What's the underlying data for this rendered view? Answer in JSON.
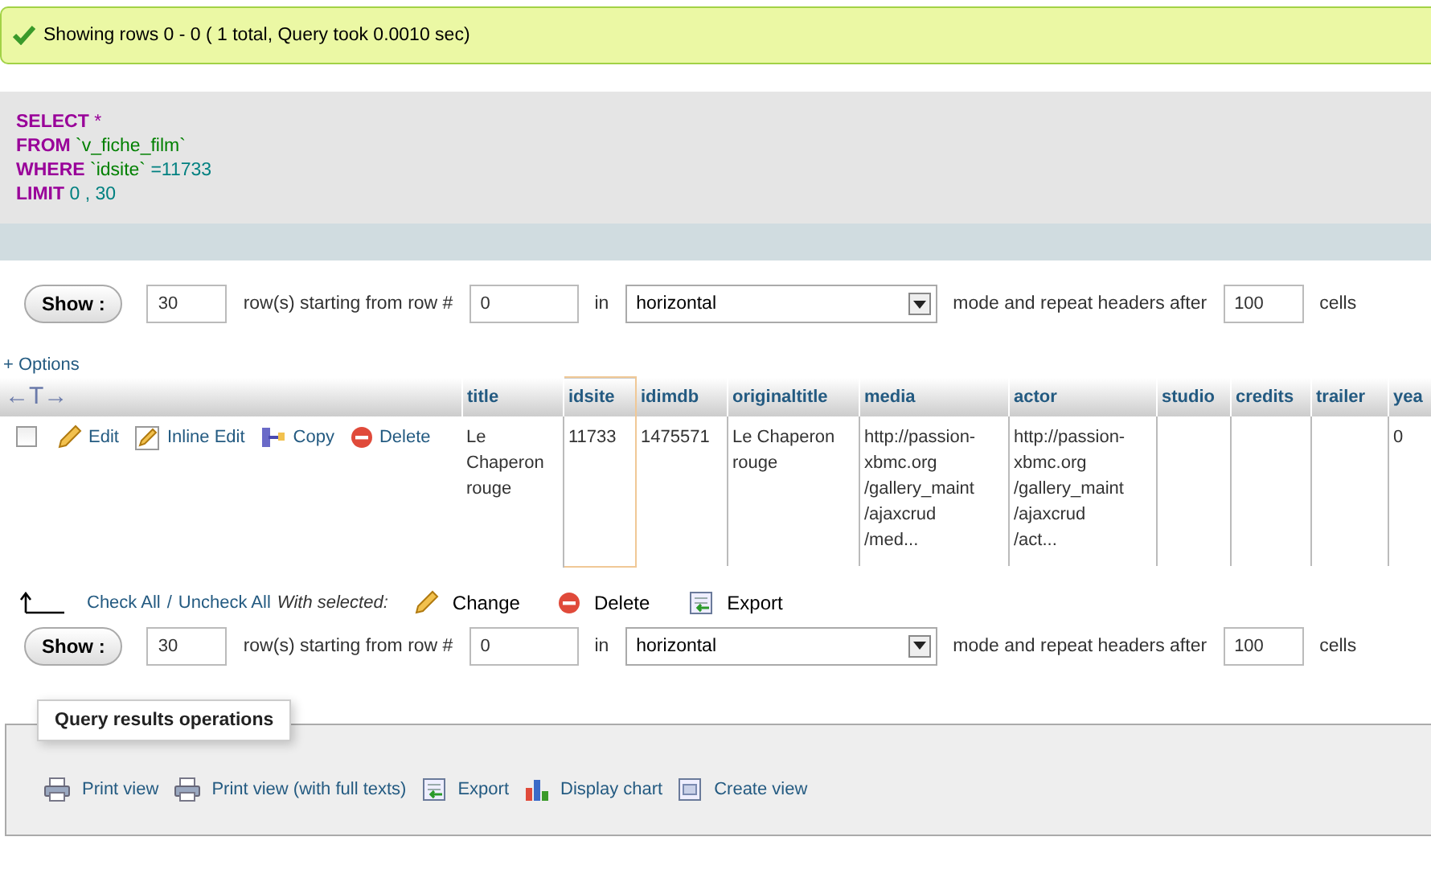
{
  "message": {
    "text": "Showing rows 0 - 0 ( 1 total, Query took 0.0010 sec)"
  },
  "sql": {
    "lines": [
      [
        {
          "kind": "keyword",
          "text": "SELECT"
        },
        {
          "kind": "keyword",
          "text": "*"
        }
      ],
      [
        {
          "kind": "keyword",
          "text": "FROM"
        },
        {
          "kind": "identifier",
          "text": "`v_fiche_film`"
        }
      ],
      [
        {
          "kind": "keyword",
          "text": "WHERE"
        },
        {
          "kind": "identifier",
          "text": "`idsite`"
        },
        {
          "kind": "number",
          "text": "=11733"
        }
      ],
      [
        {
          "kind": "keyword",
          "text": "LIMIT"
        },
        {
          "kind": "number",
          "text": "0 , 30"
        }
      ]
    ]
  },
  "nav_top": {
    "show_button": "Show :",
    "rows_value": "30",
    "rows_label": "row(s) starting from row #",
    "start_value": "0",
    "in_label": "in",
    "mode_value": "horizontal",
    "repeat_label": "mode and repeat headers after",
    "repeat_value": "100",
    "cells_label": "cells"
  },
  "options_link": "+ Options",
  "table": {
    "sort_handle": "←T→",
    "columns": [
      {
        "label": "title",
        "highlighted": false
      },
      {
        "label": "idsite",
        "highlighted": true
      },
      {
        "label": "idimdb",
        "highlighted": false
      },
      {
        "label": "originaltitle",
        "highlighted": false
      },
      {
        "label": "media",
        "highlighted": false
      },
      {
        "label": "actor",
        "highlighted": false
      },
      {
        "label": "studio",
        "highlighted": false
      },
      {
        "label": "credits",
        "highlighted": false
      },
      {
        "label": "trailer",
        "highlighted": false
      },
      {
        "label": "yea",
        "highlighted": false
      }
    ],
    "rows": [
      {
        "checked": false,
        "actions": [
          {
            "kind": "edit",
            "label": "Edit"
          },
          {
            "kind": "inline_edit",
            "label": "Inline Edit"
          },
          {
            "kind": "copy",
            "label": "Copy"
          },
          {
            "kind": "delete",
            "label": "Delete"
          }
        ],
        "cells": [
          [
            "Le",
            "Chaperon",
            "rouge"
          ],
          [
            "11733"
          ],
          [
            "1475571"
          ],
          [
            "Le Chaperon",
            "rouge"
          ],
          [
            "http://passion-",
            "xbmc.org",
            "/gallery_maint",
            "/ajaxcrud",
            "/med..."
          ],
          [
            "http://passion-",
            "xbmc.org",
            "/gallery_maint",
            "/ajaxcrud",
            "/act..."
          ],
          [],
          [],
          [],
          [
            "0"
          ]
        ]
      }
    ]
  },
  "bulk": {
    "check_all": "Check All",
    "separator": "/",
    "uncheck_all": "Uncheck All",
    "with_selected": "With selected:",
    "actions": [
      {
        "kind": "change",
        "label": "Change"
      },
      {
        "kind": "delete",
        "label": "Delete"
      },
      {
        "kind": "export",
        "label": "Export"
      }
    ]
  },
  "nav_bottom": {
    "show_button": "Show :",
    "rows_value": "30",
    "rows_label": "row(s) starting from row #",
    "start_value": "0",
    "in_label": "in",
    "mode_value": "horizontal",
    "repeat_label": "mode and repeat headers after",
    "repeat_value": "100",
    "cells_label": "cells"
  },
  "operations": {
    "title": "Query results operations",
    "links": [
      {
        "kind": "print",
        "label": "Print view"
      },
      {
        "kind": "print",
        "label": "Print view (with full texts)"
      },
      {
        "kind": "export",
        "label": "Export"
      },
      {
        "kind": "chart",
        "label": "Display chart"
      },
      {
        "kind": "view",
        "label": "Create view"
      }
    ]
  }
}
